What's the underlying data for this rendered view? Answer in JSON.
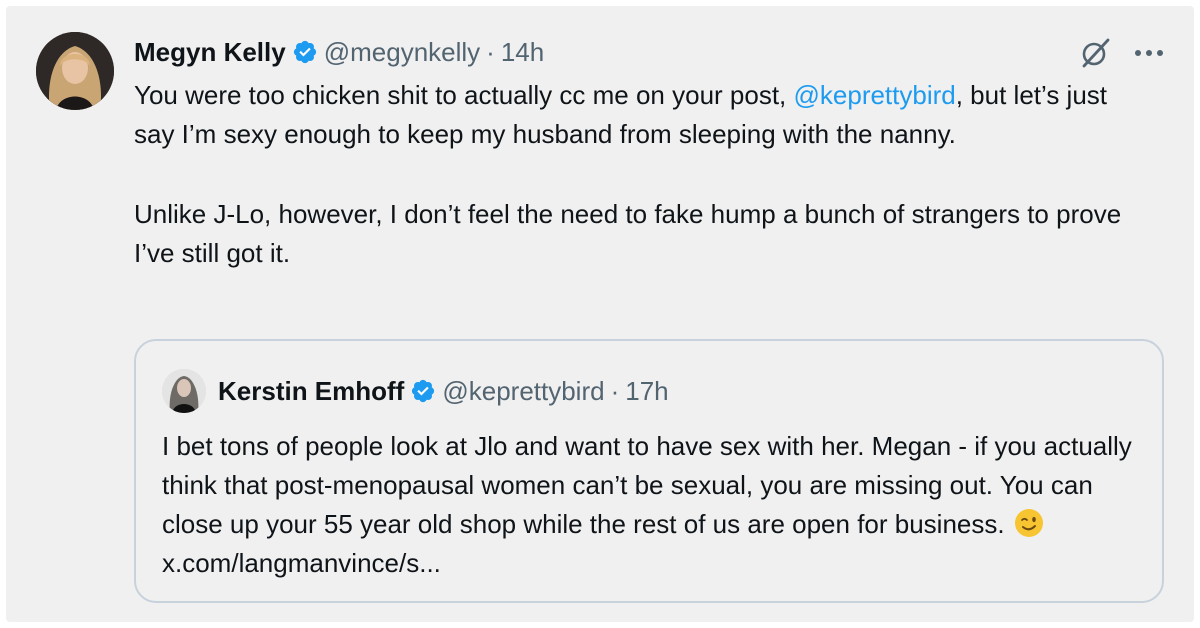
{
  "tweet": {
    "author_name": "Megyn Kelly",
    "author_handle": "@megynkelly",
    "separator": "·",
    "time": "14h",
    "text_part1": "You were too chicken shit to actually cc me on your post, ",
    "mention": "@keprettybird",
    "text_part2": ", but let’s just say I’m sexy enough to keep my husband from sleeping with the nanny.",
    "paragraph2": "Unlike J-Lo, however, I don’t feel the need to fake hump a bunch of strangers to prove I’ve still got it."
  },
  "quote": {
    "author_name": "Kerstin Emhoff",
    "author_handle": "@keprettybird",
    "separator": "·",
    "time": "17h",
    "text": "I bet tons of people look at Jlo and want to have sex with her. Megan - if you actually think that post-menopausal women can’t be sexual, you are missing out. You can close up your 55 year old shop while the rest of us are open for business.",
    "emoji": "winking-face",
    "link": "x.com/langmanvince/s..."
  },
  "icons": {
    "verified": "verified-badge-icon",
    "grok": "grok-icon",
    "more": "more-options-icon"
  },
  "colors": {
    "accent": "#1d9bf0",
    "secondary_text": "#536471",
    "background": "#f0f0f0",
    "quote_border": "#c8d2dc"
  }
}
